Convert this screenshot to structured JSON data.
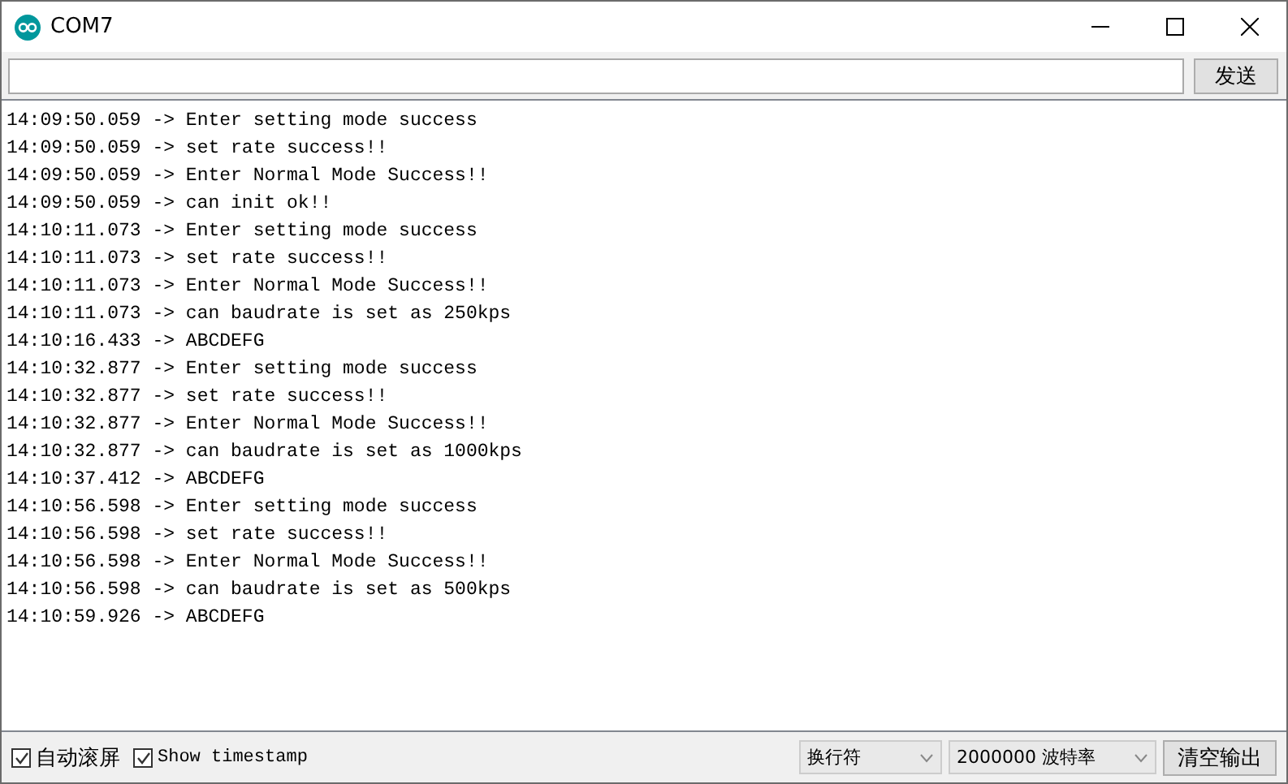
{
  "window": {
    "title": "COM7"
  },
  "send_button": "发送",
  "log": [
    "14:09:50.059 -> Enter setting mode success",
    "14:09:50.059 -> set rate success!!",
    "14:09:50.059 -> Enter Normal Mode Success!!",
    "14:09:50.059 -> can init ok!!",
    "14:10:11.073 -> Enter setting mode success",
    "14:10:11.073 -> set rate success!!",
    "14:10:11.073 -> Enter Normal Mode Success!!",
    "14:10:11.073 -> can baudrate is set as 250kps",
    "14:10:16.433 -> ABCDEFG",
    "14:10:32.877 -> Enter setting mode success",
    "14:10:32.877 -> set rate success!!",
    "14:10:32.877 -> Enter Normal Mode Success!!",
    "14:10:32.877 -> can baudrate is set as 1000kps",
    "14:10:37.412 -> ABCDEFG",
    "14:10:56.598 -> Enter setting mode success",
    "14:10:56.598 -> set rate success!!",
    "14:10:56.598 -> Enter Normal Mode Success!!",
    "14:10:56.598 -> can baudrate is set as 500kps",
    "14:10:59.926 -> ABCDEFG"
  ],
  "options": [
    {
      "label": "自动滚屏",
      "checked": true,
      "kind": "cjk"
    },
    {
      "label": "Show timestamp",
      "checked": true,
      "kind": "mono"
    }
  ],
  "line_ending": "换行符",
  "baud_rate": "2000000 波特率",
  "clear_button": "清空输出"
}
